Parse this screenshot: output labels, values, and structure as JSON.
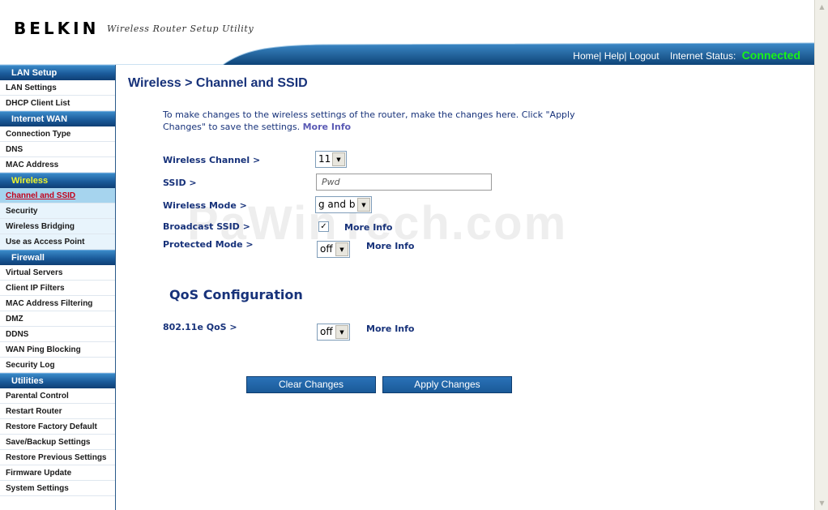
{
  "header": {
    "logo": "BELKIN",
    "subtitle": "Wireless Router Setup Utility",
    "links": "Home| Help| Logout",
    "status_label": "Internet Status:",
    "status_value": "Connected"
  },
  "sidebar": {
    "sections": [
      {
        "title": "LAN Setup",
        "items": [
          "LAN Settings",
          "DHCP Client List"
        ]
      },
      {
        "title": "Internet WAN",
        "items": [
          "Connection Type",
          "DNS",
          "MAC Address"
        ]
      },
      {
        "title": "Wireless",
        "items": [
          "Channel and SSID",
          "Security",
          "Wireless Bridging",
          "Use as Access Point"
        ]
      },
      {
        "title": "Firewall",
        "items": [
          "Virtual Servers",
          "Client IP Filters",
          "MAC Address Filtering",
          "DMZ",
          "DDNS",
          "WAN Ping Blocking",
          "Security Log"
        ]
      },
      {
        "title": "Utilities",
        "items": [
          "Parental Control",
          "Restart Router",
          "Restore Factory Default",
          "Save/Backup Settings",
          "Restore Previous Settings",
          "Firmware Update",
          "System Settings"
        ]
      }
    ]
  },
  "main": {
    "title": "Wireless > Channel and SSID",
    "intro": "To make changes to the wireless settings of the router, make the changes here. Click \"Apply Changes\" to save the settings.",
    "more_info": "More Info",
    "fields": {
      "channel_label": "Wireless Channel >",
      "channel_value": "11",
      "ssid_label": "SSID >",
      "ssid_value": "Pwd",
      "mode_label": "Wireless Mode >",
      "mode_value": "g and b",
      "broadcast_label": "Broadcast SSID >",
      "broadcast_checked": "✓",
      "protected_label": "Protected Mode >",
      "protected_value": "off"
    },
    "qos": {
      "title": "QoS Configuration",
      "label": "802.11e QoS >",
      "value": "off"
    },
    "buttons": {
      "clear": "Clear Changes",
      "apply": "Apply Changes"
    },
    "watermark": "PaWinTech.com"
  },
  "colors": {
    "accent": "#17327a",
    "nav_head": "#1a5a9a",
    "status_connected": "#19f319",
    "active_item": "#c4001a"
  }
}
